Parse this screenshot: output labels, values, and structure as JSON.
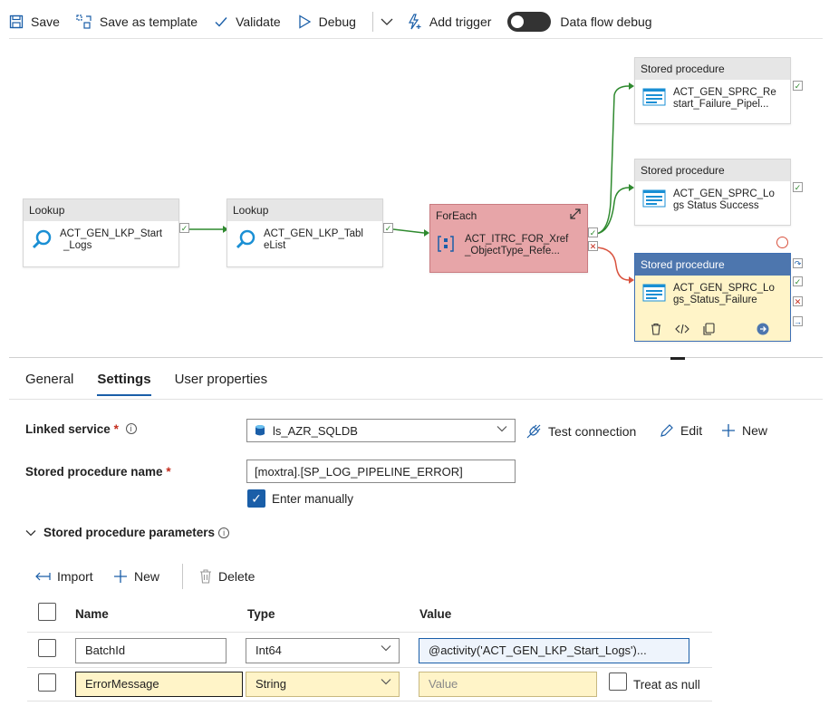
{
  "toolbar": {
    "save": "Save",
    "save_template": "Save as template",
    "validate": "Validate",
    "debug": "Debug",
    "add_trigger": "Add trigger",
    "data_flow_debug": "Data flow debug"
  },
  "pipeline": {
    "lookup1": {
      "type": "Lookup",
      "name_l1": "ACT_GEN_LKP_Start",
      "name_l2": "_Logs"
    },
    "lookup2": {
      "type": "Lookup",
      "name_l1": "ACT_GEN_LKP_Tabl",
      "name_l2": "eList"
    },
    "foreach": {
      "type": "ForEach",
      "name_l1": "ACT_ITRC_FOR_Xref",
      "name_l2": "_ObjectType_Refe..."
    },
    "sp1": {
      "type": "Stored procedure",
      "name_l1": "ACT_GEN_SPRC_Re",
      "name_l2": "start_Failure_Pipel..."
    },
    "sp2": {
      "type": "Stored procedure",
      "name_l1": "ACT_GEN_SPRC_Lo",
      "name_l2": "gs Status Success"
    },
    "sp3": {
      "type": "Stored procedure",
      "name_l1": "ACT_GEN_SPRC_Lo",
      "name_l2": "gs_Status_Failure"
    }
  },
  "tabs": [
    "General",
    "Settings",
    "User properties"
  ],
  "settings": {
    "linked_service_label": "Linked service",
    "linked_service_value": "ls_AZR_SQLDB",
    "test_connection": "Test connection",
    "edit": "Edit",
    "new": "New",
    "sp_name_label": "Stored procedure name",
    "sp_name_value": "[moxtra].[SP_LOG_PIPELINE_ERROR]",
    "enter_manually": "Enter manually",
    "params_label": "Stored procedure parameters",
    "import": "Import",
    "param_new": "New",
    "delete": "Delete"
  },
  "params_table": {
    "headers": [
      "Name",
      "Type",
      "Value"
    ],
    "rows": [
      {
        "name": "BatchId",
        "type": "Int64",
        "value": "@activity('ACT_GEN_LKP_Start_Logs')..."
      },
      {
        "name": "ErrorMessage",
        "type": "String",
        "value": "",
        "value_placeholder": "Value",
        "null_label": "Treat as null"
      }
    ]
  },
  "colors": {
    "accent": "#1a5ea8",
    "success": "#2f8a2f",
    "failure": "#c42b1c",
    "foreach_fill": "#e7a5a8",
    "selected_header": "#4d76ae"
  }
}
